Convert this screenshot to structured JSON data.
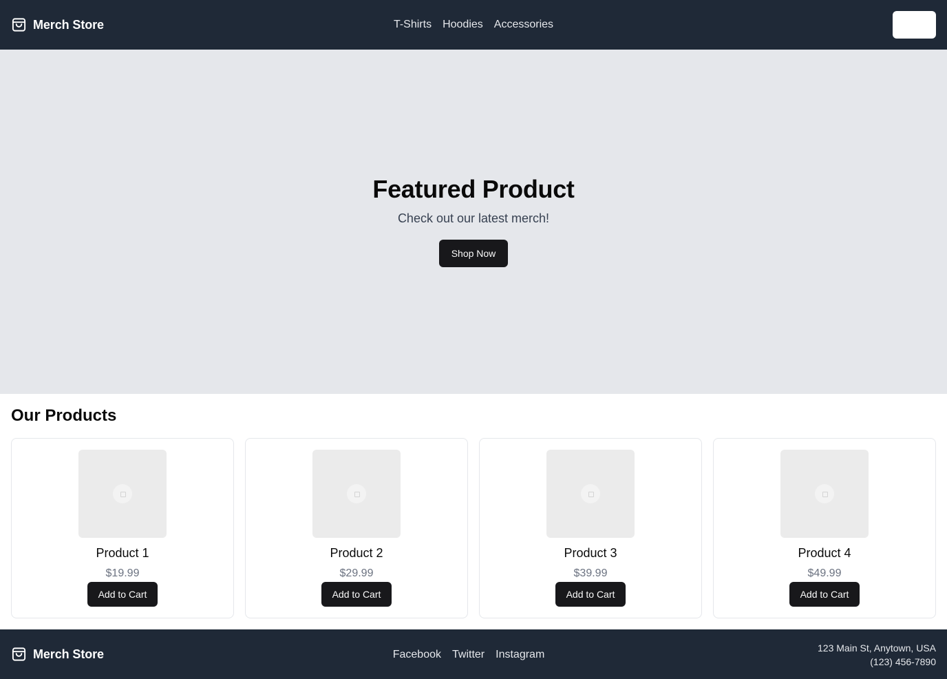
{
  "header": {
    "brand": "Merch Store",
    "nav": [
      "T-Shirts",
      "Hoodies",
      "Accessories"
    ]
  },
  "hero": {
    "title": "Featured Product",
    "subtitle": "Check out our latest merch!",
    "cta": "Shop Now"
  },
  "products_section": {
    "title": "Our Products",
    "items": [
      {
        "name": "Product 1",
        "price": "$19.99",
        "button": "Add to Cart"
      },
      {
        "name": "Product 2",
        "price": "$29.99",
        "button": "Add to Cart"
      },
      {
        "name": "Product 3",
        "price": "$39.99",
        "button": "Add to Cart"
      },
      {
        "name": "Product 4",
        "price": "$49.99",
        "button": "Add to Cart"
      }
    ]
  },
  "footer": {
    "brand": "Merch Store",
    "links": [
      "Facebook",
      "Twitter",
      "Instagram"
    ],
    "address": "123 Main St, Anytown, USA",
    "phone": "(123) 456-7890"
  },
  "icons": {
    "brand": "shopping-bag-icon",
    "product_placeholder": "image-placeholder-icon"
  },
  "colors": {
    "header_bg": "#1f2937",
    "hero_bg": "#e5e7eb",
    "button_bg": "#18181b",
    "price_text": "#6b7280"
  }
}
